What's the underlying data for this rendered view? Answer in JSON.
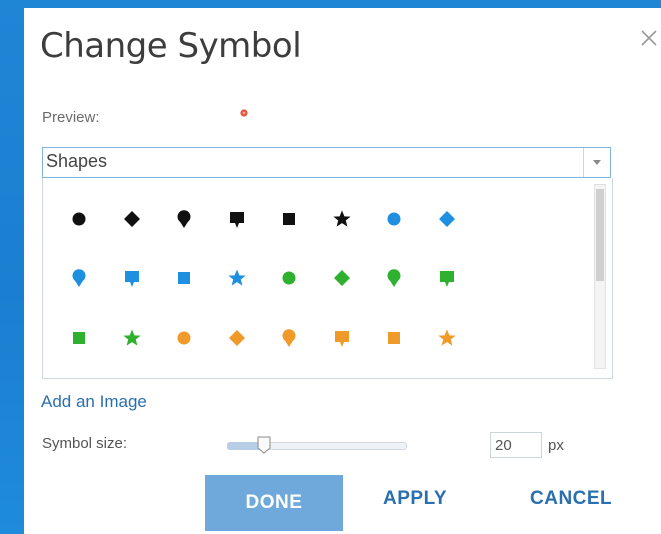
{
  "dialog": {
    "title": "Change Symbol",
    "preview_label": "Preview:",
    "preview_symbol": "red-circle-marker",
    "category_select": {
      "value": "Shapes"
    },
    "symbols": [
      [
        "black-circle-icon",
        "black-diamond-icon",
        "black-pin-icon",
        "black-callout-icon",
        "black-square-icon",
        "black-star-icon",
        "blue-circle-icon",
        "blue-diamond-icon"
      ],
      [
        "blue-pin-icon",
        "blue-callout-icon",
        "blue-square-icon",
        "blue-star-icon",
        "green-circle-icon",
        "green-diamond-icon",
        "green-pin-icon",
        "green-callout-icon"
      ],
      [
        "green-square-icon",
        "green-star-icon",
        "orange-circle-icon",
        "orange-diamond-icon",
        "orange-pin-icon",
        "orange-callout-icon",
        "orange-square-icon",
        "orange-star-icon"
      ]
    ],
    "add_image_link": "Add an Image",
    "size_label": "Symbol size:",
    "size_value": "20",
    "size_unit": "px",
    "slider_fraction": 0.21,
    "buttons": {
      "done": "DONE",
      "apply": "APPLY",
      "cancel": "CANCEL"
    }
  },
  "colors": {
    "black": "#111111",
    "blue": "#1f8fe0",
    "green": "#2fb12f",
    "orange": "#f09a2a",
    "preview": "#e2553a",
    "link": "#2a6fb0",
    "done_button": "#6fa9db"
  }
}
